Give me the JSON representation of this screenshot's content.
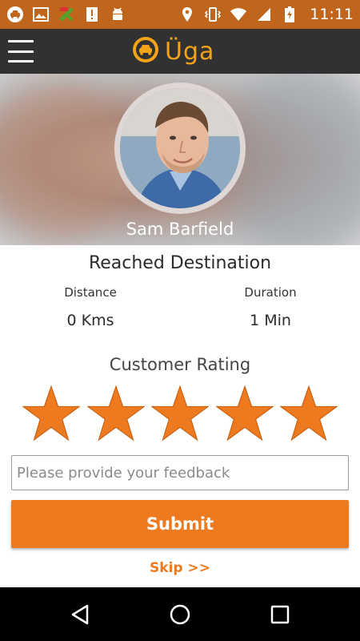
{
  "status_bar": {
    "time": "11:11",
    "left_icons": [
      "car-notification-icon",
      "image-notification-icon",
      "fake-gps-icon",
      "alert-notification-icon",
      "android-debug-icon"
    ],
    "right_icons": [
      "location-icon",
      "vibrate-icon",
      "wifi-icon",
      "signal-icon",
      "battery-charging-icon"
    ]
  },
  "app_bar": {
    "brand_name": "Üga",
    "menu_icon": "hamburger-menu-icon",
    "logo_icon": "taxi-logo-icon"
  },
  "driver": {
    "name": "Sam Barfield"
  },
  "trip": {
    "status_title": "Reached Destination",
    "distance_label": "Distance",
    "distance_value": "0 Kms",
    "duration_label": "Duration",
    "duration_value": "1 Min"
  },
  "rating": {
    "label": "Customer Rating",
    "value": 5,
    "max": 5
  },
  "feedback": {
    "placeholder": "Please provide your feedback",
    "value": ""
  },
  "actions": {
    "submit_label": "Submit",
    "skip_label": "Skip >>"
  },
  "nav_bar": {
    "icons": [
      "back-icon",
      "home-icon",
      "recents-icon"
    ]
  },
  "colors": {
    "status_bar": "#c0651c",
    "app_bar": "#313131",
    "accent": "#ee7a1f",
    "brand": "#f3a21a"
  }
}
